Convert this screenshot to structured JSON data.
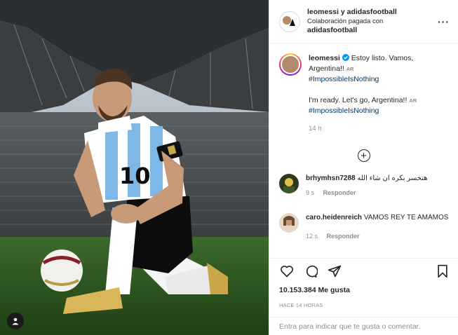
{
  "header": {
    "title": "leomessi y adidasfootball",
    "subtitle": "Colaboración pagada con",
    "partner": "adidasfootball",
    "more_label": "···"
  },
  "caption": {
    "username": "leomessi",
    "line1": "Estoy listo. Vamos, Argentina!!",
    "ar1": "AR",
    "hashtag1": "#ImpossibleIsNothing",
    "line2": "I'm ready. Let's go, Argentina!!",
    "ar2": "AR",
    "hashtag2": "#ImpossibleIsNothing",
    "time": "14 h"
  },
  "load_more_label": "+",
  "comments": [
    {
      "username": "brhymhsn7288",
      "text": "هتخسر بكره ان شاء الله",
      "time": "9 s",
      "reply": "Responder"
    },
    {
      "username": "caro.heidenreich",
      "text": "VAMOS REY TE AMAMOS",
      "time": "12 s",
      "reply": "Responder"
    }
  ],
  "likes": "10.153.384 Me gusta",
  "posted_ago": "HACE 14 HORAS",
  "comment_input": {
    "placeholder": "Entra para indicar que te gusta o comentar."
  },
  "jersey": {
    "number": "10"
  },
  "icons": {
    "more": "more-icon",
    "verified": "verified-badge-icon",
    "like": "heart-icon",
    "comment": "comment-icon",
    "share": "share-icon",
    "save": "bookmark-icon",
    "tagged": "user-tag-icon",
    "load_more": "plus-circle-icon"
  },
  "colors": {
    "link": "#00376b",
    "muted": "#8e8e8e",
    "text": "#262626",
    "verified": "#0095f6"
  }
}
